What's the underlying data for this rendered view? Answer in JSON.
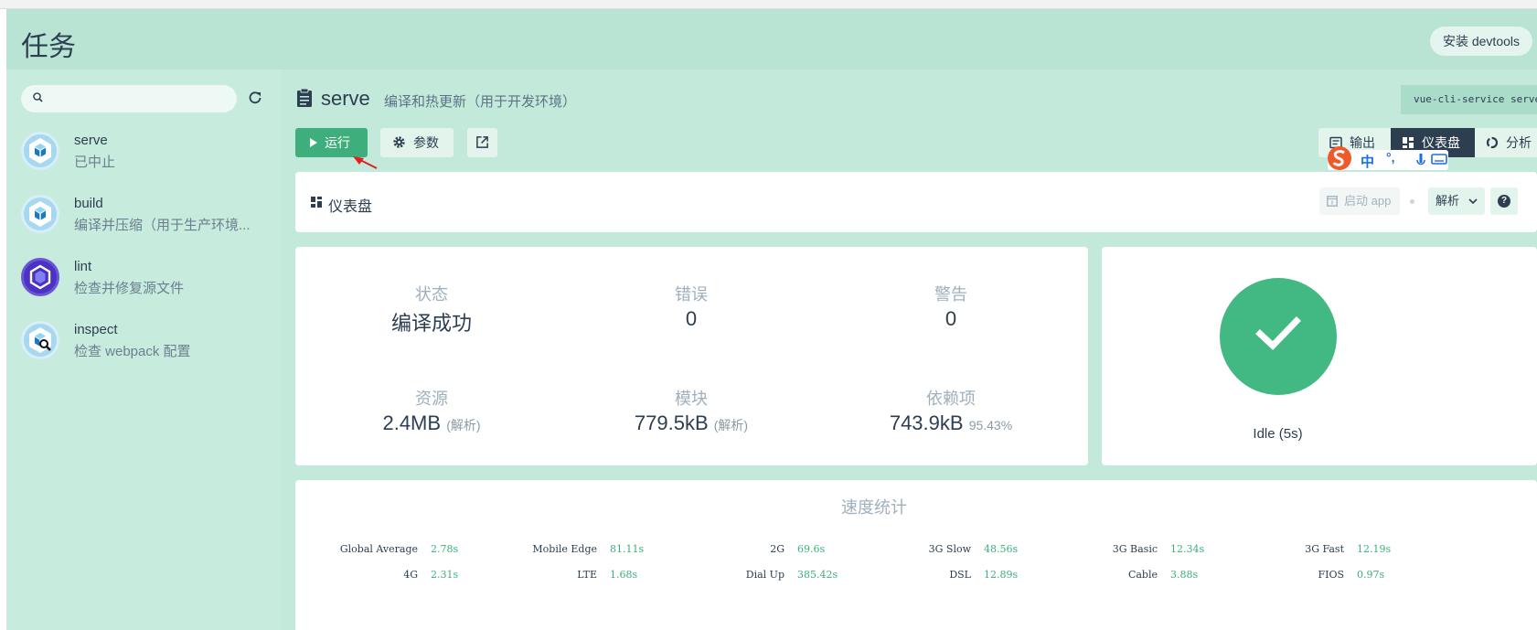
{
  "header": {
    "title": "任务",
    "devtools_label": "安装 devtools"
  },
  "sidebar": {
    "search": {
      "placeholder": "",
      "value": ""
    },
    "tasks": [
      {
        "name": "serve",
        "description": "已中止"
      },
      {
        "name": "build",
        "description": "编译并压缩（用于生产环境..."
      },
      {
        "name": "lint",
        "description": "检查并修复源文件"
      },
      {
        "name": "inspect",
        "description": "检查 webpack 配置"
      }
    ]
  },
  "task": {
    "name": "serve",
    "description": "编译和热更新（用于开发环境）",
    "command": "vue-cli-service serve",
    "run_label": "运行",
    "params_label": "参数"
  },
  "tabs": {
    "output": "输出",
    "dashboard": "仪表盘",
    "analyze": "分析"
  },
  "ime": {
    "lang": "中",
    "punct": "°,"
  },
  "dashboard": {
    "title": "仪表盘",
    "start_app": "启动 app",
    "select_value": "解析"
  },
  "stats": {
    "status": {
      "label": "状态",
      "value": "编译成功"
    },
    "errors": {
      "label": "错误",
      "value": "0"
    },
    "warnings": {
      "label": "警告",
      "value": "0"
    },
    "assets": {
      "label": "资源",
      "value": "2.4MB",
      "sub": "(解析)"
    },
    "modules": {
      "label": "模块",
      "value": "779.5kB",
      "sub": "(解析)"
    },
    "deps": {
      "label": "依赖项",
      "value": "743.9kB",
      "sub": "95.43%"
    }
  },
  "status_card": {
    "idle": "Idle (5s)"
  },
  "speed": {
    "title": "速度统计",
    "row1": [
      {
        "name": "Global Average",
        "value": "2.78s"
      },
      {
        "name": "Mobile Edge",
        "value": "81.11s"
      },
      {
        "name": "2G",
        "value": "69.6s"
      },
      {
        "name": "3G Slow",
        "value": "48.56s"
      },
      {
        "name": "3G Basic",
        "value": "12.34s"
      },
      {
        "name": "3G Fast",
        "value": "12.19s"
      }
    ],
    "row2": [
      {
        "name": "4G",
        "value": "2.31s"
      },
      {
        "name": "LTE",
        "value": "1.68s"
      },
      {
        "name": "Dial Up",
        "value": "385.42s"
      },
      {
        "name": "DSL",
        "value": "12.89s"
      },
      {
        "name": "Cable",
        "value": "3.88s"
      },
      {
        "name": "FIOS",
        "value": "0.97s"
      }
    ]
  },
  "colors": {
    "accent": "#3eaf7c",
    "dark": "#2c3e50",
    "success": "#42b983",
    "header_bg": "#b9e4d4"
  }
}
